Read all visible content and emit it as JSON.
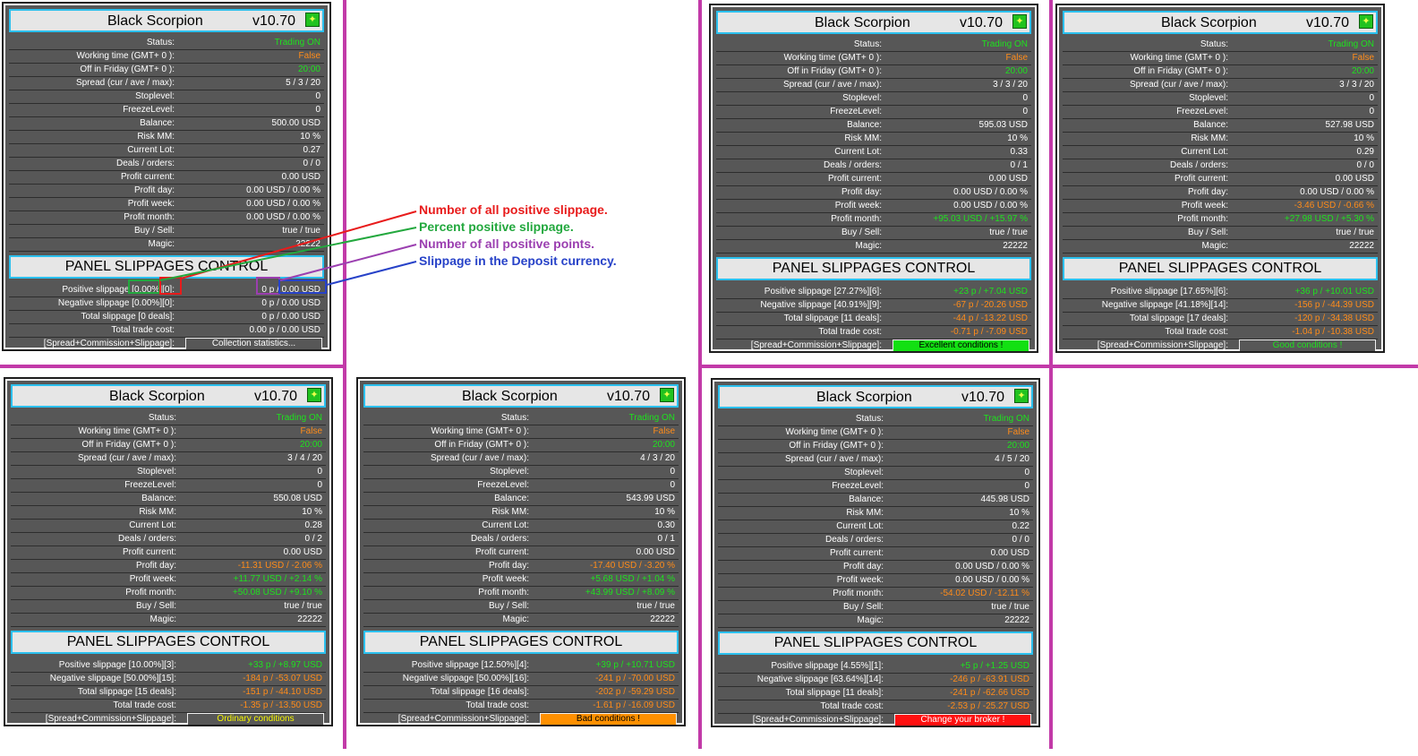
{
  "colors": {
    "divider": "#c23aa8",
    "panel_bg": "#575757",
    "header_border": "#2bc0ee",
    "green": "#1ee21e",
    "orange": "#ff8c1a",
    "annotation_red": "#e81b1b",
    "annotation_green": "#23a83e",
    "annotation_purple": "#9b3fb0",
    "annotation_blue": "#2742c8"
  },
  "labels": {
    "title": "Black Scorpion",
    "version": "v10.70",
    "status": "Status:",
    "working_time": "Working time (GMT+ 0 ):",
    "off_friday": "Off in Friday (GMT+ 0 ):",
    "spread": "Spread (cur / ave / max):",
    "stoplevel": "Stoplevel:",
    "freezelevel": "FreezeLevel:",
    "balance": "Balance:",
    "risk_mm": "Risk MM:",
    "current_lot": "Current Lot:",
    "deals_orders": "Deals / orders:",
    "profit_current": "Profit current:",
    "profit_day": "Profit day:",
    "profit_week": "Profit week:",
    "profit_month": "Profit month:",
    "buy_sell": "Buy / Sell:",
    "magic": "Magic:",
    "slippage_panel_title": "PANEL SLIPPAGES CONTROL",
    "total_trade_cost": "Total trade cost:",
    "spread_comm_slip": "[Spread+Commission+Slippage]:",
    "settings_icon": "settings-icon"
  },
  "annotations": {
    "a1": "Number of all positive slippage.",
    "a2": "Percent positive slippage.",
    "a3": "Number of all positive points.",
    "a4": "Slippage in the Deposit currency."
  },
  "panels": [
    {
      "status": {
        "text": "Trading ON",
        "color": "green"
      },
      "working_time": {
        "text": "False",
        "color": "orange"
      },
      "off_friday": {
        "text": "20:00",
        "color": "green"
      },
      "spread": {
        "text": "5 / 3 / 20",
        "color": "white"
      },
      "stoplevel": {
        "text": "0",
        "color": "white"
      },
      "freezelevel": {
        "text": "0",
        "color": "white"
      },
      "balance": {
        "text": "500.00  USD",
        "color": "white"
      },
      "risk_mm": {
        "text": "10 %",
        "color": "white"
      },
      "current_lot": {
        "text": "0.27",
        "color": "white"
      },
      "deals_orders": {
        "text": "0  /  0",
        "color": "white"
      },
      "profit_current": {
        "text": "0.00 USD",
        "color": "white"
      },
      "profit_day": {
        "text": "0.00 USD / 0.00 %",
        "color": "white"
      },
      "profit_week": {
        "text": "0.00 USD / 0.00 %",
        "color": "white"
      },
      "profit_month": {
        "text": "0.00 USD / 0.00 %",
        "color": "white"
      },
      "buy_sell": {
        "text": "true  /  true",
        "color": "white"
      },
      "magic": {
        "text": "22222",
        "color": "white"
      },
      "positive_slippage": {
        "label": "Positive slippage [0.00%][0]:",
        "text": "0 p / 0.00 USD",
        "color": "white"
      },
      "negative_slippage": {
        "label": "Negative slippage [0.00%][0]:",
        "text": "0 p / 0.00 USD",
        "color": "white"
      },
      "total_slippage": {
        "label": "Total slippage [0 deals]:",
        "text": "0 p / 0.00 USD",
        "color": "white"
      },
      "total_trade_cost": {
        "text": "0.00 p / 0.00 USD",
        "color": "white"
      },
      "condition": {
        "text": "Collection statistics...",
        "bg": "#575757",
        "fg": "#ffffff"
      }
    },
    {
      "status": {
        "text": "Trading ON",
        "color": "green"
      },
      "working_time": {
        "text": "False",
        "color": "orange"
      },
      "off_friday": {
        "text": "20:00",
        "color": "green"
      },
      "spread": {
        "text": "3 / 3 / 20",
        "color": "white"
      },
      "stoplevel": {
        "text": "0",
        "color": "white"
      },
      "freezelevel": {
        "text": "0",
        "color": "white"
      },
      "balance": {
        "text": "595.03  USD",
        "color": "white"
      },
      "risk_mm": {
        "text": "10 %",
        "color": "white"
      },
      "current_lot": {
        "text": "0.33",
        "color": "white"
      },
      "deals_orders": {
        "text": "0  /  1",
        "color": "white"
      },
      "profit_current": {
        "text": "0.00 USD",
        "color": "white"
      },
      "profit_day": {
        "text": "0.00 USD / 0.00 %",
        "color": "white"
      },
      "profit_week": {
        "text": "0.00 USD / 0.00 %",
        "color": "white"
      },
      "profit_month": {
        "text": "+95.03 USD / +15.97 %",
        "color": "green"
      },
      "buy_sell": {
        "text": "true  /  true",
        "color": "white"
      },
      "magic": {
        "text": "22222",
        "color": "white"
      },
      "positive_slippage": {
        "label": "Positive slippage [27.27%][6]:",
        "text": "+23 p / +7.04 USD",
        "color": "green"
      },
      "negative_slippage": {
        "label": "Negative slippage [40.91%][9]:",
        "text": "-67 p / -20.26 USD",
        "color": "orange"
      },
      "total_slippage": {
        "label": "Total slippage [11 deals]:",
        "text": "-44 p / -13.22 USD",
        "color": "orange"
      },
      "total_trade_cost": {
        "text": "-0.71 p / -7.09 USD",
        "color": "orange"
      },
      "condition": {
        "text": "Excellent conditions !",
        "bg": "#12e012",
        "fg": "#000000"
      }
    },
    {
      "status": {
        "text": "Trading ON",
        "color": "green"
      },
      "working_time": {
        "text": "False",
        "color": "orange"
      },
      "off_friday": {
        "text": "20:00",
        "color": "green"
      },
      "spread": {
        "text": "3 / 3 / 20",
        "color": "white"
      },
      "stoplevel": {
        "text": "0",
        "color": "white"
      },
      "freezelevel": {
        "text": "0",
        "color": "white"
      },
      "balance": {
        "text": "527.98  USD",
        "color": "white"
      },
      "risk_mm": {
        "text": "10 %",
        "color": "white"
      },
      "current_lot": {
        "text": "0.29",
        "color": "white"
      },
      "deals_orders": {
        "text": "0  /  0",
        "color": "white"
      },
      "profit_current": {
        "text": "0.00 USD",
        "color": "white"
      },
      "profit_day": {
        "text": "0.00 USD / 0.00 %",
        "color": "white"
      },
      "profit_week": {
        "text": "-3.46 USD / -0.66 %",
        "color": "orange"
      },
      "profit_month": {
        "text": "+27.98 USD / +5.30 %",
        "color": "green"
      },
      "buy_sell": {
        "text": "true  /  true",
        "color": "white"
      },
      "magic": {
        "text": "22222",
        "color": "white"
      },
      "positive_slippage": {
        "label": "Positive slippage [17.65%][6]:",
        "text": "+36 p / +10.01 USD",
        "color": "green"
      },
      "negative_slippage": {
        "label": "Negative slippage [41.18%][14]:",
        "text": "-156 p / -44.39 USD",
        "color": "orange"
      },
      "total_slippage": {
        "label": "Total slippage [17 deals]:",
        "text": "-120 p / -34.38 USD",
        "color": "orange"
      },
      "total_trade_cost": {
        "text": "-1.04 p / -10.38 USD",
        "color": "orange"
      },
      "condition": {
        "text": "Good conditions !",
        "bg": "#575757",
        "fg": "#1ee21e"
      }
    },
    {
      "status": {
        "text": "Trading ON",
        "color": "green"
      },
      "working_time": {
        "text": "False",
        "color": "orange"
      },
      "off_friday": {
        "text": "20:00",
        "color": "green"
      },
      "spread": {
        "text": "3 / 4 / 20",
        "color": "white"
      },
      "stoplevel": {
        "text": "0",
        "color": "white"
      },
      "freezelevel": {
        "text": "0",
        "color": "white"
      },
      "balance": {
        "text": "550.08  USD",
        "color": "white"
      },
      "risk_mm": {
        "text": "10 %",
        "color": "white"
      },
      "current_lot": {
        "text": "0.28",
        "color": "white"
      },
      "deals_orders": {
        "text": "0  /  2",
        "color": "white"
      },
      "profit_current": {
        "text": "0.00 USD",
        "color": "white"
      },
      "profit_day": {
        "text": "-11.31 USD / -2.06 %",
        "color": "orange"
      },
      "profit_week": {
        "text": "+11.77 USD / +2.14 %",
        "color": "green"
      },
      "profit_month": {
        "text": "+50.08 USD / +9.10 %",
        "color": "green"
      },
      "buy_sell": {
        "text": "true  /  true",
        "color": "white"
      },
      "magic": {
        "text": "22222",
        "color": "white"
      },
      "positive_slippage": {
        "label": "Positive slippage [10.00%][3]:",
        "text": "+33 p / +8.97 USD",
        "color": "green"
      },
      "negative_slippage": {
        "label": "Negative slippage [50.00%][15]:",
        "text": "-184 p / -53.07 USD",
        "color": "orange"
      },
      "total_slippage": {
        "label": "Total slippage [15 deals]:",
        "text": "-151 p / -44.10 USD",
        "color": "orange"
      },
      "total_trade_cost": {
        "text": "-1.35 p / -13.50 USD",
        "color": "orange"
      },
      "condition": {
        "text": "Ordinary conditions",
        "bg": "#575757",
        "fg": "#f6f600"
      }
    },
    {
      "status": {
        "text": "Trading ON",
        "color": "green"
      },
      "working_time": {
        "text": "False",
        "color": "orange"
      },
      "off_friday": {
        "text": "20:00",
        "color": "green"
      },
      "spread": {
        "text": "4 / 3 / 20",
        "color": "white"
      },
      "stoplevel": {
        "text": "0",
        "color": "white"
      },
      "freezelevel": {
        "text": "0",
        "color": "white"
      },
      "balance": {
        "text": "543.99  USD",
        "color": "white"
      },
      "risk_mm": {
        "text": "10 %",
        "color": "white"
      },
      "current_lot": {
        "text": "0.30",
        "color": "white"
      },
      "deals_orders": {
        "text": "0  /  1",
        "color": "white"
      },
      "profit_current": {
        "text": "0.00 USD",
        "color": "white"
      },
      "profit_day": {
        "text": "-17.40 USD / -3.20 %",
        "color": "orange"
      },
      "profit_week": {
        "text": "+5.68 USD / +1.04 %",
        "color": "green"
      },
      "profit_month": {
        "text": "+43.99 USD / +8.09 %",
        "color": "green"
      },
      "buy_sell": {
        "text": "true  /  true",
        "color": "white"
      },
      "magic": {
        "text": "22222",
        "color": "white"
      },
      "positive_slippage": {
        "label": "Positive slippage [12.50%][4]:",
        "text": "+39 p / +10.71 USD",
        "color": "green"
      },
      "negative_slippage": {
        "label": "Negative slippage [50.00%][16]:",
        "text": "-241 p / -70.00 USD",
        "color": "orange"
      },
      "total_slippage": {
        "label": "Total slippage [16 deals]:",
        "text": "-202 p / -59.29 USD",
        "color": "orange"
      },
      "total_trade_cost": {
        "text": "-1.61 p / -16.09 USD",
        "color": "orange"
      },
      "condition": {
        "text": "Bad conditions !",
        "bg": "#ff9000",
        "fg": "#000000"
      }
    },
    {
      "status": {
        "text": "Trading ON",
        "color": "green"
      },
      "working_time": {
        "text": "False",
        "color": "orange"
      },
      "off_friday": {
        "text": "20:00",
        "color": "green"
      },
      "spread": {
        "text": "4 / 5 / 20",
        "color": "white"
      },
      "stoplevel": {
        "text": "0",
        "color": "white"
      },
      "freezelevel": {
        "text": "0",
        "color": "white"
      },
      "balance": {
        "text": "445.98  USD",
        "color": "white"
      },
      "risk_mm": {
        "text": "10 %",
        "color": "white"
      },
      "current_lot": {
        "text": "0.22",
        "color": "white"
      },
      "deals_orders": {
        "text": "0  /  0",
        "color": "white"
      },
      "profit_current": {
        "text": "0.00 USD",
        "color": "white"
      },
      "profit_day": {
        "text": "0.00 USD / 0.00 %",
        "color": "white"
      },
      "profit_week": {
        "text": "0.00 USD / 0.00 %",
        "color": "white"
      },
      "profit_month": {
        "text": "-54.02 USD / -12.11 %",
        "color": "orange"
      },
      "buy_sell": {
        "text": "true  /  true",
        "color": "white"
      },
      "magic": {
        "text": "22222",
        "color": "white"
      },
      "positive_slippage": {
        "label": "Positive slippage [4.55%][1]:",
        "text": "+5 p / +1.25 USD",
        "color": "green"
      },
      "negative_slippage": {
        "label": "Negative slippage [63.64%][14]:",
        "text": "-246 p / -63.91 USD",
        "color": "orange"
      },
      "total_slippage": {
        "label": "Total slippage [11 deals]:",
        "text": "-241 p / -62.66 USD",
        "color": "orange"
      },
      "total_trade_cost": {
        "text": "-2.53 p / -25.27 USD",
        "color": "orange"
      },
      "condition": {
        "text": "Change your broker !",
        "bg": "#ff1010",
        "fg": "#ffffff"
      }
    }
  ]
}
